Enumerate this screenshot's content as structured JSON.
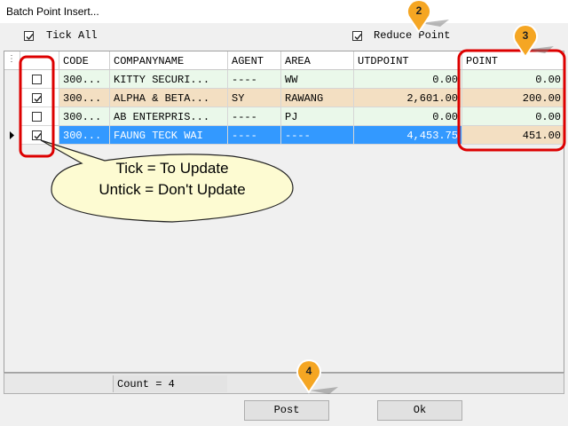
{
  "window": {
    "title": "Batch Point Insert..."
  },
  "top_options": {
    "tick_all_label": "Tick All",
    "reduce_point_label": "Reduce Point"
  },
  "table": {
    "columns": [
      "CODE",
      "COMPANYNAME",
      "AGENT",
      "AREA",
      "UTDPOINT",
      "POINT"
    ],
    "rows": [
      {
        "checked": false,
        "code": "300...",
        "company": "KITTY SECURI...",
        "agent": "----",
        "area": "WW",
        "utdpoint": "0.00",
        "point": "0.00",
        "bg": "#eaf8ea"
      },
      {
        "checked": true,
        "code": "300...",
        "company": "ALPHA & BETA...",
        "agent": "SY",
        "area": "RAWANG",
        "utdpoint": "2,601.00",
        "point": "200.00",
        "bg": "#f3dfc2"
      },
      {
        "checked": false,
        "code": "300...",
        "company": "AB ENTERPRIS...",
        "agent": "----",
        "area": "PJ",
        "utdpoint": "0.00",
        "point": "0.00",
        "bg": "#eaf8ea"
      },
      {
        "checked": true,
        "code": "300...",
        "company": "FAUNG TECK WAI",
        "agent": "----",
        "area": "----",
        "utdpoint": "4,453.75",
        "point": "451.00",
        "bg": "#3399ff"
      }
    ]
  },
  "status": {
    "count_text": "Count = 4"
  },
  "buttons": {
    "post_label": "Post",
    "ok_label": "Ok"
  },
  "annotations": {
    "callout_line1": "Tick = To Update",
    "callout_line2": "Untick = Don't Update",
    "markers": [
      "2",
      "3",
      "4"
    ]
  },
  "colors": {
    "highlight": "#dd0000",
    "marker": "#f5a623",
    "selected_row": "#3399ff"
  }
}
